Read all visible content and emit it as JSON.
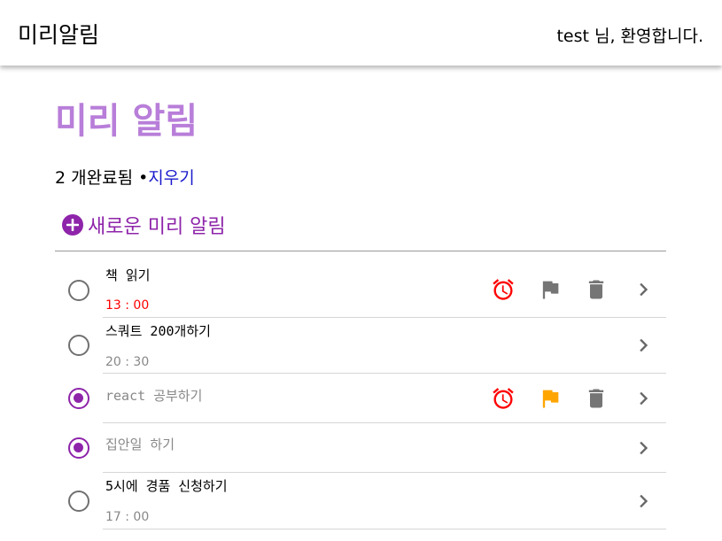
{
  "header": {
    "app_title": "미리알림",
    "welcome": "test 님, 환영합니다."
  },
  "main": {
    "title": "미리 알림",
    "completed_count": "2 개완료됨 •",
    "clear_label": "지우기",
    "new_label": "새로운 미리 알림"
  },
  "colors": {
    "accent": "#8e24aa",
    "title": "#b87ed9",
    "alarm": "#ff0000",
    "flag_active": "#ffa500",
    "icon_gray": "#757575"
  },
  "tasks": [
    {
      "title": "책 읽기",
      "time": "13 : 00",
      "completed": false,
      "icons": [
        "alarm-icon",
        "flag-icon",
        "trash-icon",
        "chevron-right-icon"
      ]
    },
    {
      "title": "스쿼트 200개하기",
      "time": "20 : 30",
      "completed": false,
      "icons": [
        "chevron-right-icon"
      ]
    },
    {
      "title": "react 공부하기",
      "time": "",
      "completed": true,
      "icons": [
        "alarm-icon",
        "flag-icon",
        "trash-icon",
        "chevron-right-icon"
      ]
    },
    {
      "title": "집안일 하기",
      "time": "",
      "completed": true,
      "icons": [
        "chevron-right-icon"
      ]
    },
    {
      "title": "5시에 경품 신청하기",
      "time": "17 : 00",
      "completed": false,
      "icons": [
        "chevron-right-icon"
      ]
    }
  ]
}
